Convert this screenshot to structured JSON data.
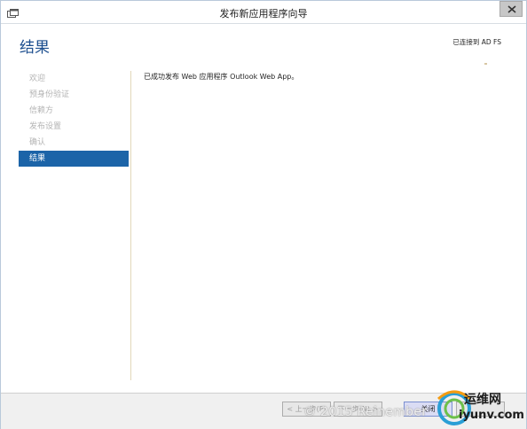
{
  "window": {
    "title": "发布新应用程序向导"
  },
  "header": {
    "page_title": "结果",
    "connection_status": "已连接到 AD FS"
  },
  "nav": {
    "items": [
      {
        "label": "欢迎",
        "active": false
      },
      {
        "label": "预身份验证",
        "active": false
      },
      {
        "label": "信赖方",
        "active": false
      },
      {
        "label": "发布设置",
        "active": false
      },
      {
        "label": "确认",
        "active": false
      },
      {
        "label": "结果",
        "active": true
      }
    ]
  },
  "content": {
    "message": "已成功发布 Web 应用程序 Outlook Web App。"
  },
  "footer": {
    "prev_label": "< 上一步(P)",
    "next_label": "下一步(N) >",
    "close_label": "关闭",
    "cancel_label": ""
  },
  "overlay": {
    "watermark": "© 2015 Reinember",
    "logo_cn": "运维网",
    "logo_en": "iyunv.com"
  },
  "icons": {
    "app": "app-window-icon",
    "close": "close-icon"
  },
  "colors": {
    "accent": "#1c64a8",
    "title_blue": "#1d4f8f"
  }
}
